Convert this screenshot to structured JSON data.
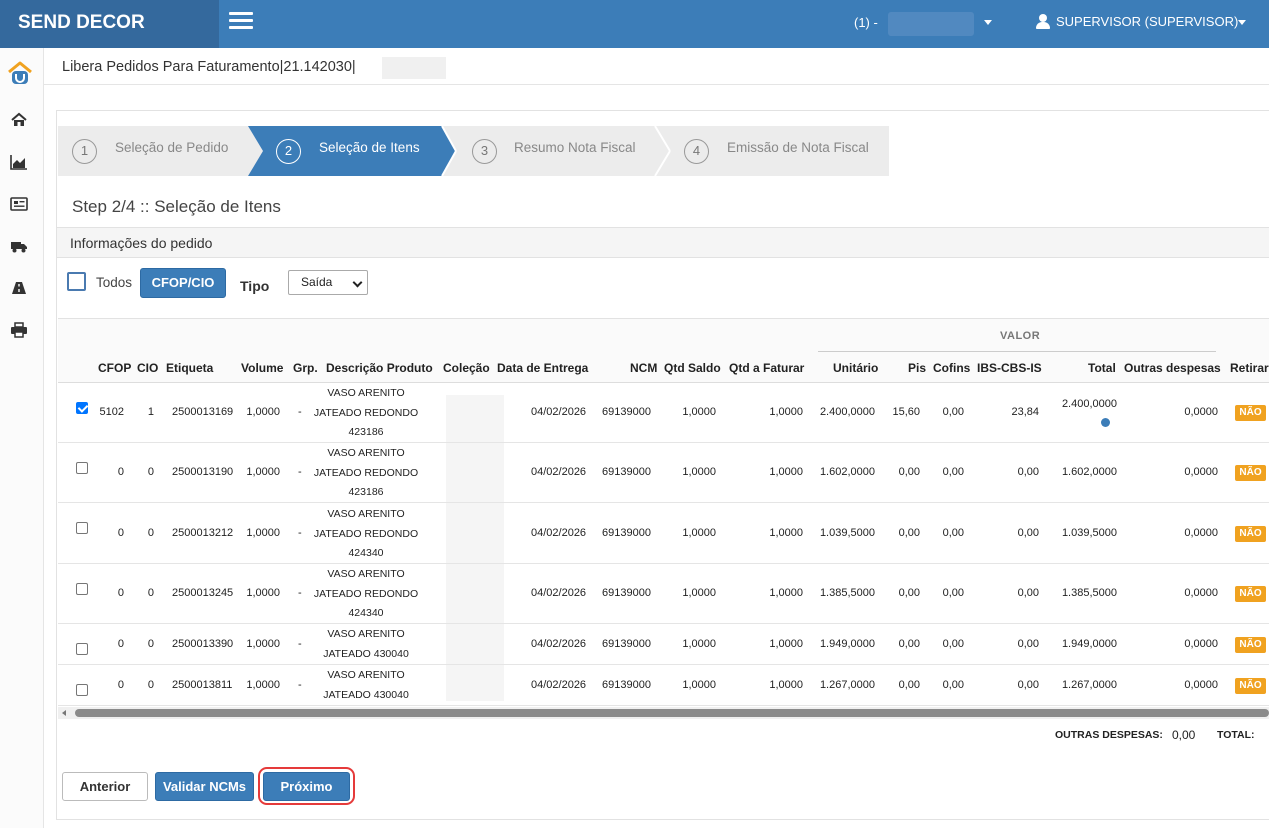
{
  "header": {
    "brand": "SEND DECOR",
    "company": "(1) -",
    "user": "SUPERVISOR (SUPERVISOR)"
  },
  "sidebar": {
    "icons": [
      "home-icon",
      "chart-icon",
      "newspaper-icon",
      "truck-icon",
      "road-icon",
      "print-icon"
    ]
  },
  "breadcrumb": "Libera Pedidos Para Faturamento|21.142030|",
  "wizard": {
    "steps": [
      {
        "num": "1",
        "label": "Seleção de Pedido"
      },
      {
        "num": "2",
        "label": "Seleção de Itens"
      },
      {
        "num": "3",
        "label": "Resumo Nota Fiscal"
      },
      {
        "num": "4",
        "label": "Emissão de Nota Fiscal"
      }
    ],
    "active": 2
  },
  "page_title": "Step 2/4 :: Seleção de Itens",
  "info_title": "Informações do pedido",
  "filters": {
    "todos_label": "Todos",
    "cfop_button": "CFOP/CIO",
    "tipo_label": "Tipo",
    "tipo_value": "Saída"
  },
  "table": {
    "group_header": "VALOR",
    "columns": [
      "CFOP",
      "CIO",
      "Etiqueta",
      "Volume",
      "Grp.",
      "Descrição Produto",
      "Coleção",
      "Data de Entrega",
      "NCM",
      "Qtd Saldo",
      "Qtd a Faturar",
      "Unitário",
      "Pis",
      "Cofins",
      "IBS-CBS-IS",
      "Total",
      "Outras despesas",
      "Retirar"
    ],
    "rows": [
      {
        "checked": true,
        "cfop": "5102",
        "cio": "1",
        "etiqueta": "2500013169",
        "volume": "1,0000",
        "grp": "-",
        "desc": [
          "VASO ARENITO",
          "JATEADO REDONDO",
          "423186"
        ],
        "data": "04/02/2026",
        "ncm": "69139000",
        "saldo": "1,0000",
        "faturar": "1,0000",
        "unitario": "2.400,0000",
        "pis": "15,60",
        "cofins": "0,00",
        "ibs": "23,84",
        "total": "2.400,0000",
        "outras": "0,0000",
        "retirar": "NÃO"
      },
      {
        "checked": false,
        "cfop": "0",
        "cio": "0",
        "etiqueta": "2500013190",
        "volume": "1,0000",
        "grp": "-",
        "desc": [
          "VASO ARENITO",
          "JATEADO REDONDO",
          "423186"
        ],
        "data": "04/02/2026",
        "ncm": "69139000",
        "saldo": "1,0000",
        "faturar": "1,0000",
        "unitario": "1.602,0000",
        "pis": "0,00",
        "cofins": "0,00",
        "ibs": "0,00",
        "total": "1.602,0000",
        "outras": "0,0000",
        "retirar": "NÃO"
      },
      {
        "checked": false,
        "cfop": "0",
        "cio": "0",
        "etiqueta": "2500013212",
        "volume": "1,0000",
        "grp": "-",
        "desc": [
          "VASO ARENITO",
          "JATEADO REDONDO",
          "424340"
        ],
        "data": "04/02/2026",
        "ncm": "69139000",
        "saldo": "1,0000",
        "faturar": "1,0000",
        "unitario": "1.039,5000",
        "pis": "0,00",
        "cofins": "0,00",
        "ibs": "0,00",
        "total": "1.039,5000",
        "outras": "0,0000",
        "retirar": "NÃO"
      },
      {
        "checked": false,
        "cfop": "0",
        "cio": "0",
        "etiqueta": "2500013245",
        "volume": "1,0000",
        "grp": "-",
        "desc": [
          "VASO ARENITO",
          "JATEADO REDONDO",
          "424340"
        ],
        "data": "04/02/2026",
        "ncm": "69139000",
        "saldo": "1,0000",
        "faturar": "1,0000",
        "unitario": "1.385,5000",
        "pis": "0,00",
        "cofins": "0,00",
        "ibs": "0,00",
        "total": "1.385,5000",
        "outras": "0,0000",
        "retirar": "NÃO"
      },
      {
        "checked": false,
        "cfop": "0",
        "cio": "0",
        "etiqueta": "2500013390",
        "volume": "1,0000",
        "grp": "-",
        "desc": [
          "VASO ARENITO",
          "JATEADO 430040"
        ],
        "data": "04/02/2026",
        "ncm": "69139000",
        "saldo": "1,0000",
        "faturar": "1,0000",
        "unitario": "1.949,0000",
        "pis": "0,00",
        "cofins": "0,00",
        "ibs": "0,00",
        "total": "1.949,0000",
        "outras": "0,0000",
        "retirar": "NÃO"
      },
      {
        "checked": false,
        "cfop": "0",
        "cio": "0",
        "etiqueta": "2500013811",
        "volume": "1,0000",
        "grp": "-",
        "desc": [
          "VASO ARENITO",
          "JATEADO 430040"
        ],
        "data": "04/02/2026",
        "ncm": "69139000",
        "saldo": "1,0000",
        "faturar": "1,0000",
        "unitario": "1.267,0000",
        "pis": "0,00",
        "cofins": "0,00",
        "ibs": "0,00",
        "total": "1.267,0000",
        "outras": "0,0000",
        "retirar": "NÃO"
      }
    ]
  },
  "totals": {
    "outras_label": "OUTRAS DESPESAS:",
    "outras_value": "0,00",
    "total_label": "TOTAL:"
  },
  "buttons": {
    "anterior": "Anterior",
    "validar": "Validar NCMs",
    "proximo": "Próximo"
  },
  "colors": {
    "header": "#3c7db8",
    "brand_bg": "#34699d",
    "badge": "#f0a220",
    "highlight": "#e53a3a"
  }
}
